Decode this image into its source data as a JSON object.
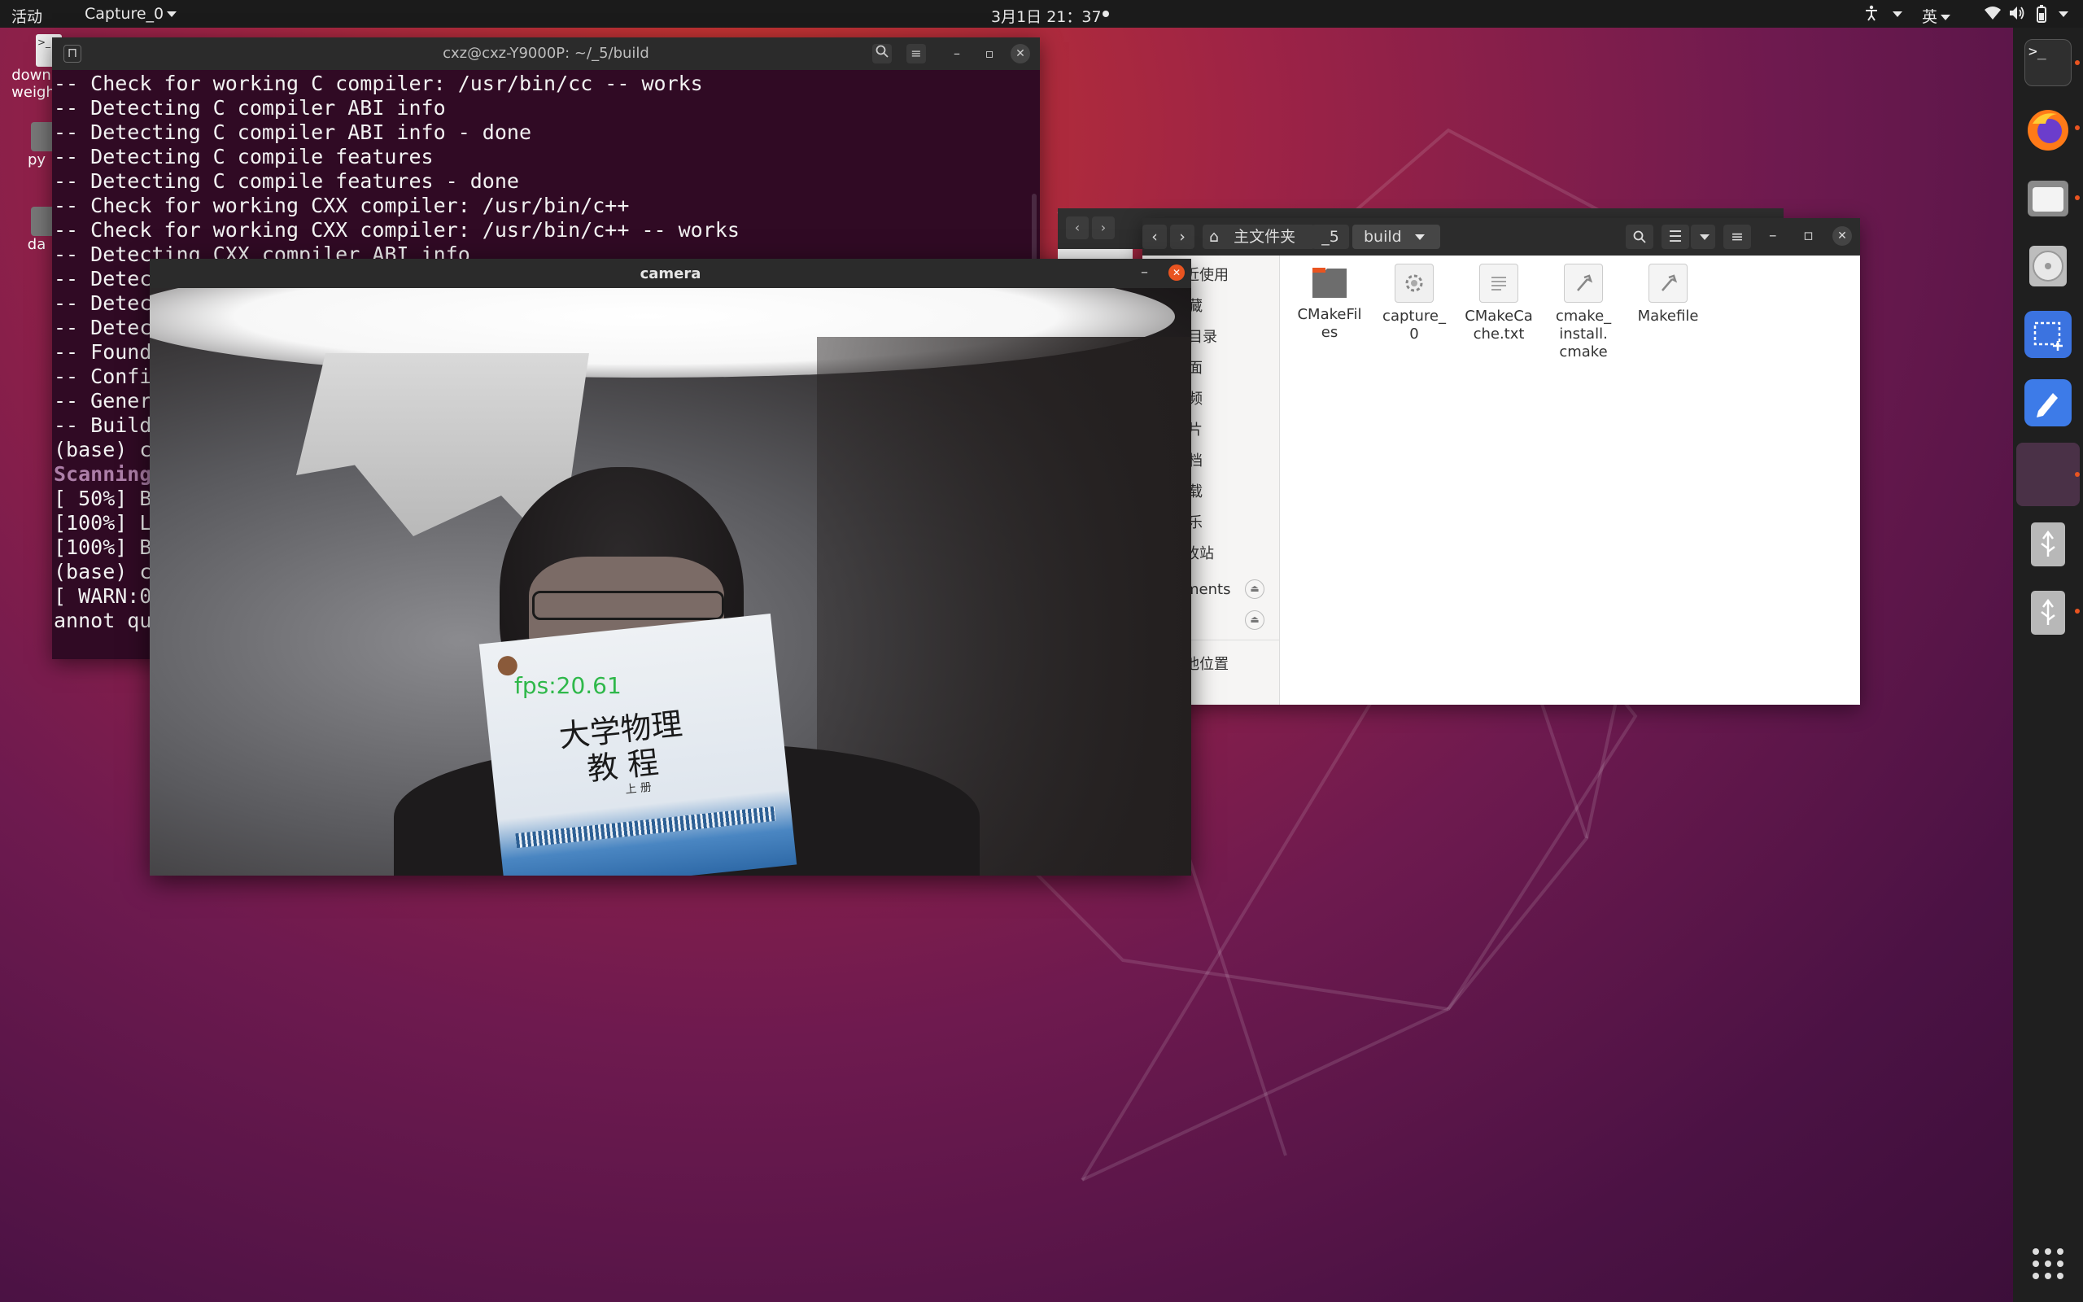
{
  "topbar": {
    "activities": "活动",
    "app_menu": "Capture_0",
    "clock": "3月1日 21：37",
    "input_method": "英"
  },
  "desktop": {
    "icons": [
      {
        "label": "downl\nweigh"
      },
      {
        "label": "py"
      },
      {
        "label": "da"
      }
    ]
  },
  "terminal": {
    "title": "cxz@cxz-Y9000P: ~/_5/build",
    "lines": [
      "-- Check for working C compiler: /usr/bin/cc -- works",
      "-- Detecting C compiler ABI info",
      "-- Detecting C compiler ABI info - done",
      "-- Detecting C compile features",
      "-- Detecting C compile features - done",
      "-- Check for working CXX compiler: /usr/bin/c++",
      "-- Check for working CXX compiler: /usr/bin/c++ -- works",
      "-- Detecting CXX compiler ABI info",
      "-- Detec",
      "-- Detec",
      "-- Detec",
      "-- Found",
      "-- Confi",
      "-- Gener",
      "-- Build",
      "(base) c",
      "Scanning",
      "[ 50%] B",
      "[100%] L",
      "[100%] B",
      "(base) c",
      "[ WARN:0",
      "annot qu"
    ]
  },
  "file_manager": {
    "path": [
      "主文件夹",
      "_5",
      "build"
    ],
    "sidebar": [
      "近使用",
      "藏",
      "目录",
      "面",
      "频",
      "片",
      "档",
      "载",
      "乐",
      "收站",
      "ments",
      "他位置"
    ],
    "files": [
      {
        "name": "CMakeFiles",
        "label": "CMakeFil\nes",
        "icon": "folder-icon"
      },
      {
        "name": "capture_0",
        "label": "capture_\n0",
        "icon": "executable-icon"
      },
      {
        "name": "CMakeCache.txt",
        "label": "CMakeCa\nche.txt",
        "icon": "text-file-icon"
      },
      {
        "name": "cmake_install.cmake",
        "label": "cmake_\ninstall.\ncmake",
        "icon": "script-file-icon"
      },
      {
        "name": "Makefile",
        "label": "Makefile",
        "icon": "script-file-icon"
      }
    ]
  },
  "camera": {
    "title": "camera",
    "fps_overlay": "fps:20.61",
    "book_title_line1": "大学物理",
    "book_title_line2": "教 程",
    "book_volume": "上 册"
  },
  "colors": {
    "terminal_bg": "#300a24",
    "accent": "#e95420",
    "green_text": "#4e9a06"
  }
}
